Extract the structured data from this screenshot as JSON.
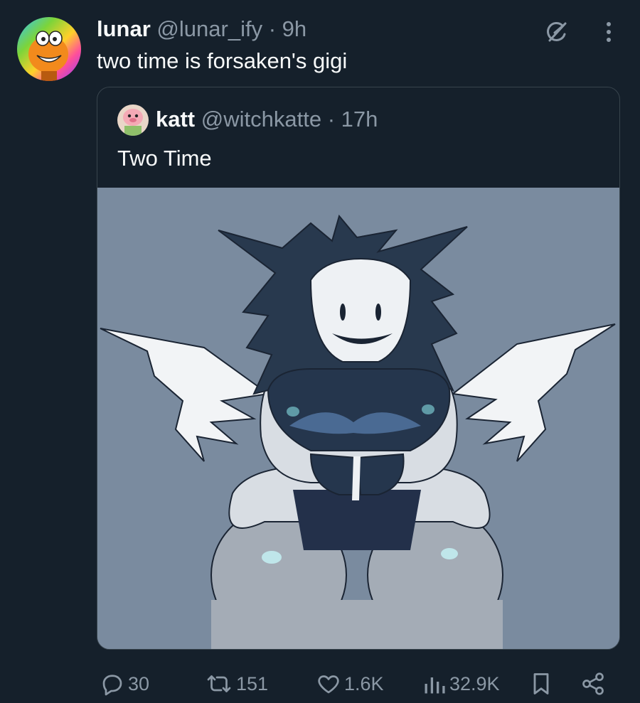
{
  "author": {
    "display_name": "lunar",
    "handle": "@lunar_ify",
    "time": "· 9h"
  },
  "tweet_text": "two time is forsaken's gigi",
  "quoted": {
    "display_name": "katt",
    "handle": "@witchkatte",
    "time": "· 17h",
    "text": "Two Time"
  },
  "actions": {
    "replies": "30",
    "reposts": "151",
    "likes": "1.6K",
    "views": "32.9K"
  },
  "icons": {
    "grok": "grok-icon",
    "more": "more-vertical-icon",
    "reply": "reply-icon",
    "repost": "repost-icon",
    "like": "heart-icon",
    "views": "views-icon",
    "bookmark": "bookmark-icon",
    "share": "share-icon"
  },
  "colors": {
    "background": "#15202b",
    "text": "#f7f9f9",
    "muted": "#8b98a5",
    "border": "#38444d",
    "media_bg": "#7a8b9f"
  }
}
